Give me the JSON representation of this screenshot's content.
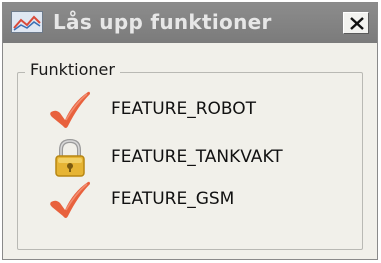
{
  "window": {
    "title": "Lås upp funktioner",
    "close_icon": "close-x-icon",
    "app_icon": "chart-icon"
  },
  "groupbox": {
    "legend": "Funktioner"
  },
  "features": [
    {
      "label": "FEATURE_ROBOT",
      "status": "unlocked",
      "icon": "checkmark-icon"
    },
    {
      "label": "FEATURE_TANKVAKT",
      "status": "locked",
      "icon": "padlock-icon"
    },
    {
      "label": "FEATURE_GSM",
      "status": "unlocked",
      "icon": "checkmark-icon"
    }
  ],
  "colors": {
    "titlebar": "#808080",
    "title_text": "#e7e7e7",
    "checkmark": "#e8613d",
    "padlock": "#e6b434"
  }
}
